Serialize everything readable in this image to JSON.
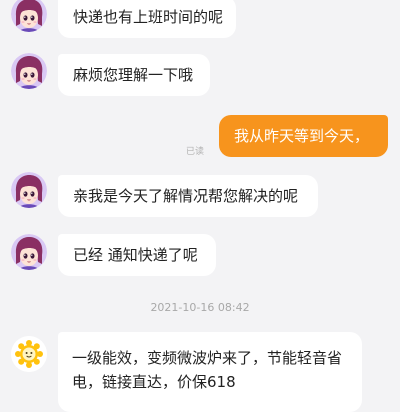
{
  "messages": [
    {
      "side": "left",
      "text": "快递也有上班时间的呢"
    },
    {
      "side": "left",
      "text": "麻烦您理解一下哦"
    },
    {
      "side": "right",
      "text": "我从昨天等到今天，",
      "status": "已读"
    },
    {
      "side": "left",
      "text": "亲我是今天了解情况帮您解决的呢"
    },
    {
      "side": "left",
      "text": "已经 通知快递了呢"
    }
  ],
  "timestamp": "2021-10-16 08:42",
  "promo": {
    "text": "一级能效，变频微波炉来了，节能轻音省电，链接直达，价保618"
  },
  "colors": {
    "background": "#f3f3f5",
    "own_bubble": "#f7941d",
    "other_bubble": "#ffffff",
    "text": "#222222",
    "muted": "#a8a8a8"
  },
  "icons": {
    "agent_avatar": "anime-girl-avatar",
    "shop_avatar": "sun-mascot-avatar"
  }
}
